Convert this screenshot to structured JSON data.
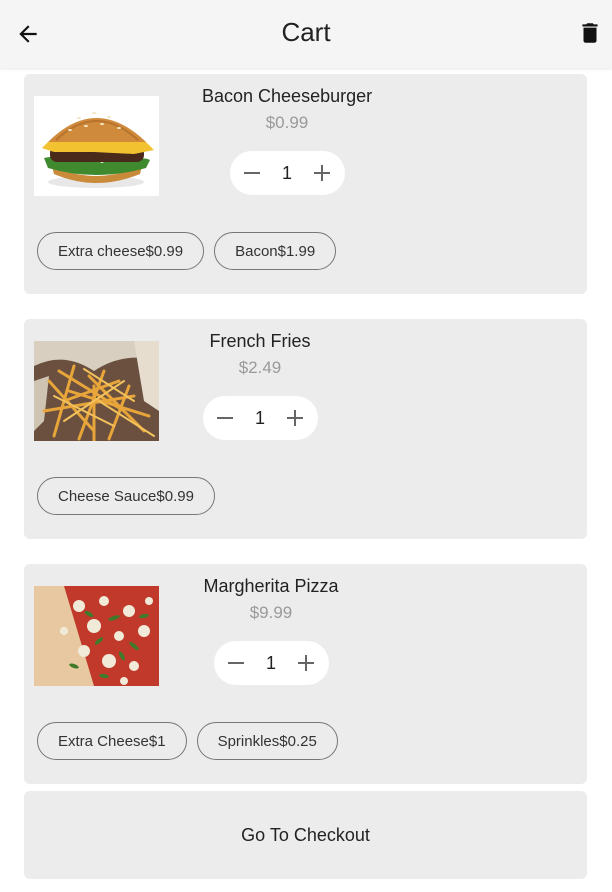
{
  "header": {
    "title": "Cart",
    "back_icon": "arrow-left-icon",
    "delete_icon": "trash-icon"
  },
  "items": [
    {
      "name": "Bacon Cheeseburger",
      "price": "$0.99",
      "quantity": "1",
      "image": "burger-image",
      "addons": [
        "Extra cheese$0.99",
        "Bacon$1.99"
      ]
    },
    {
      "name": "French Fries",
      "price": "$2.49",
      "quantity": "1",
      "image": "fries-image",
      "addons": [
        "Cheese Sauce$0.99"
      ]
    },
    {
      "name": "Margherita Pizza",
      "price": "$9.99",
      "quantity": "1",
      "image": "pizza-image",
      "addons": [
        "Extra Cheese$1",
        "Sprinkles$0.25"
      ]
    }
  ],
  "checkout": {
    "label": "Go To Checkout"
  },
  "colors": {
    "appbar_bg": "#f5f5f5",
    "card_bg": "#ececec",
    "price_text": "#9a9a9a",
    "chip_border": "#777777"
  }
}
